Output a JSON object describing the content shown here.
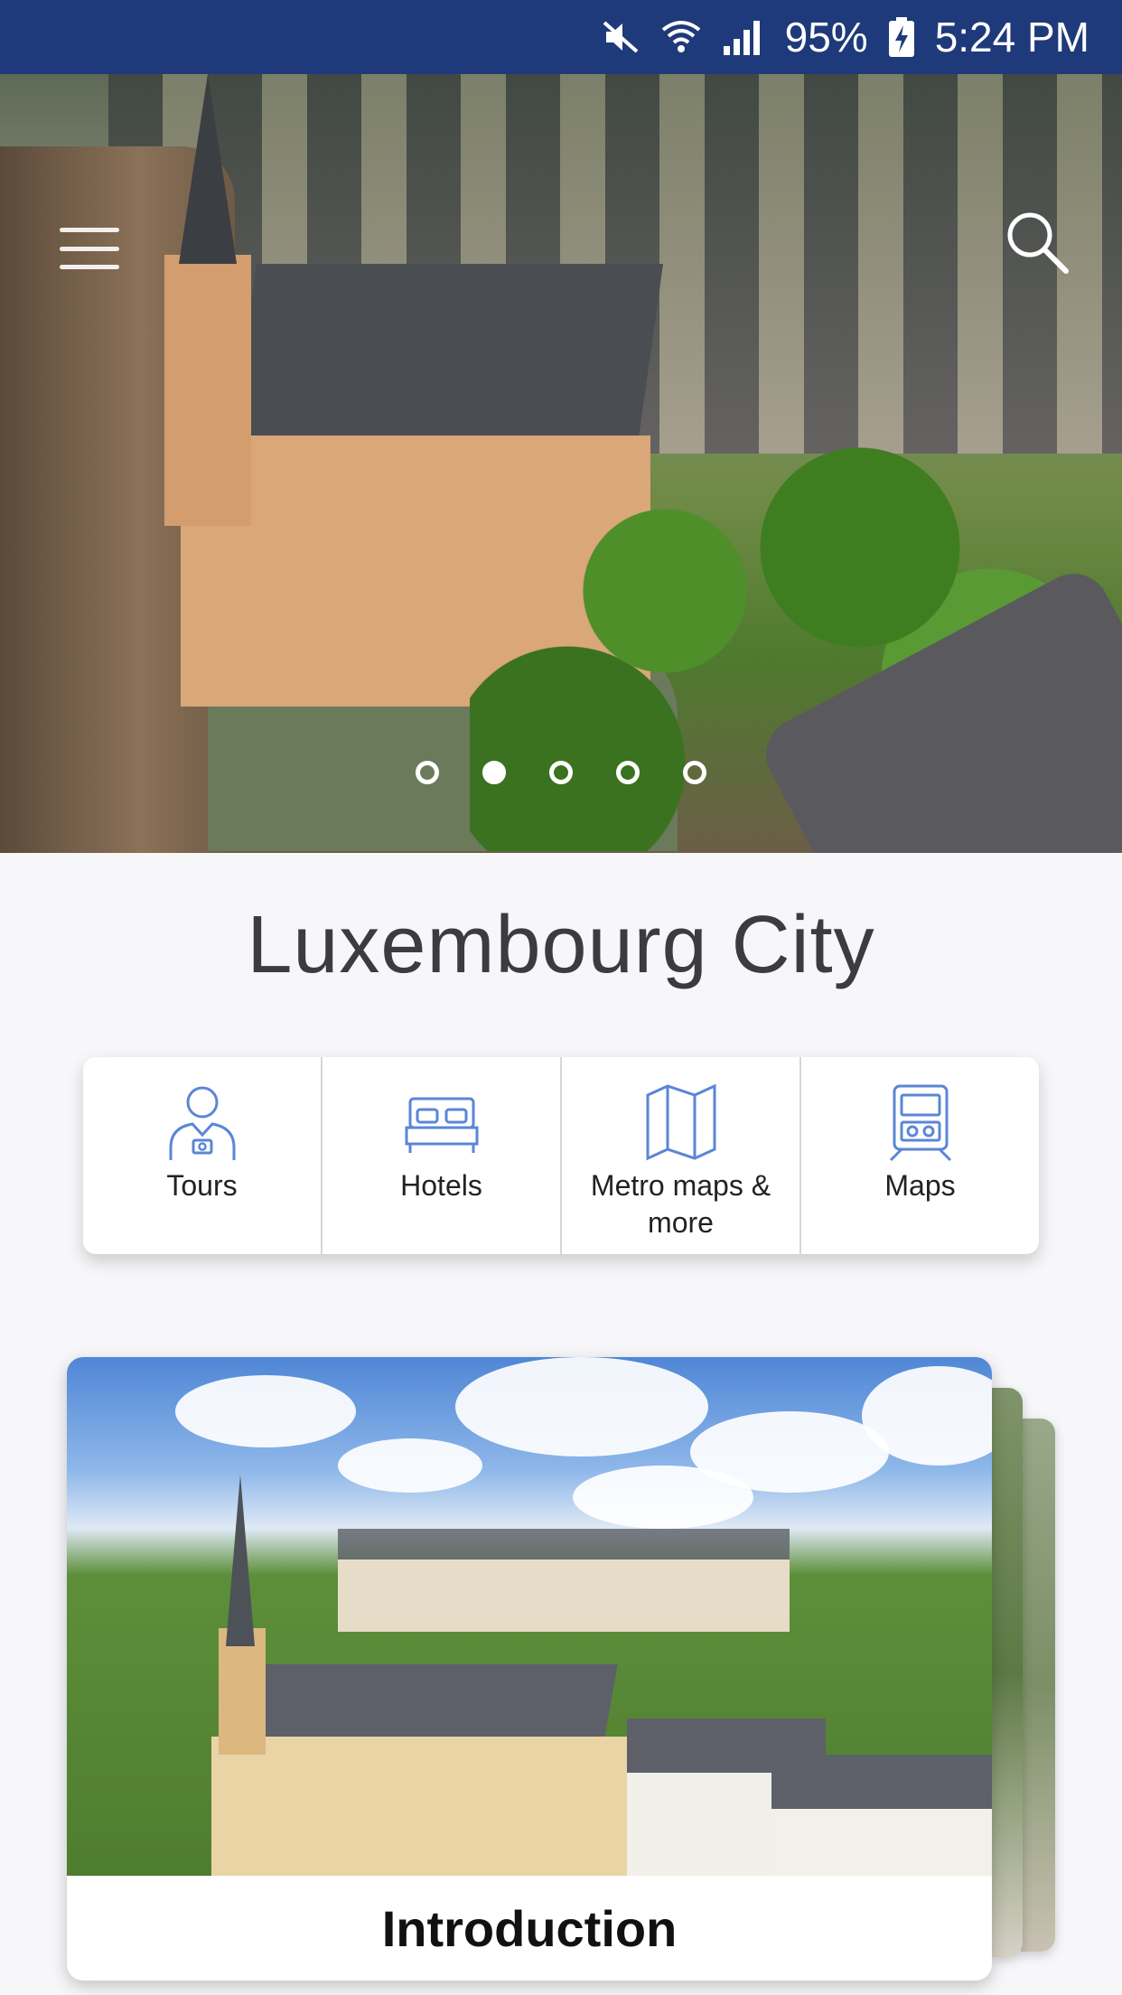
{
  "status_bar": {
    "battery": "95%",
    "time": "5:24 PM"
  },
  "hero": {
    "slides_total": 5,
    "active_slide": 2
  },
  "city": {
    "title": "Luxembourg City"
  },
  "categories": [
    {
      "label": "Tours",
      "icon": "tourist-icon"
    },
    {
      "label": "Hotels",
      "icon": "bed-icon"
    },
    {
      "label": "Metro maps & more",
      "icon": "map-icon"
    },
    {
      "label": "Maps",
      "icon": "tram-icon"
    }
  ],
  "cards": [
    {
      "caption": "Introduction"
    }
  ],
  "colors": {
    "status_bar": "#1f3a7a",
    "icon_blue": "#5b86d6",
    "title_text": "#3b3b40"
  }
}
